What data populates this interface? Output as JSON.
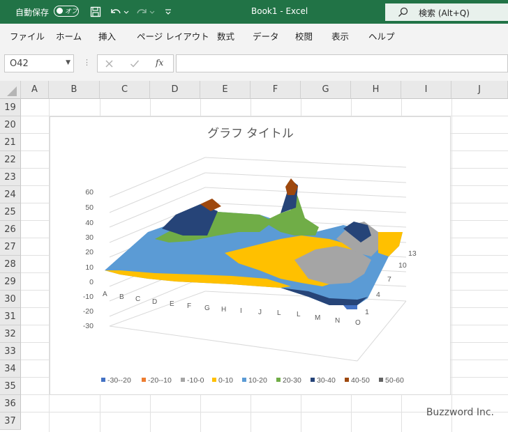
{
  "titlebar": {
    "autosave_label": "自動保存",
    "autosave_state": "オフ",
    "window_title": "Book1  -  Excel",
    "search_label": "検索 (Alt+Q)",
    "accent": "#217346"
  },
  "menu": [
    "ファイル",
    "ホーム",
    "挿入",
    "ページ レイアウト",
    "数式",
    "データ",
    "校閲",
    "表示",
    "ヘルプ"
  ],
  "formula_bar": {
    "name_box": "O42",
    "fx_label": "fx",
    "formula": ""
  },
  "columns": [
    "A",
    "B",
    "C",
    "D",
    "E",
    "F",
    "G",
    "H",
    "I",
    "J"
  ],
  "rows": [
    "19",
    "20",
    "21",
    "22",
    "23",
    "24",
    "25",
    "26",
    "27",
    "28",
    "29",
    "30",
    "31",
    "32",
    "33",
    "34",
    "35",
    "36",
    "37"
  ],
  "chart_data": {
    "type": "surface",
    "title": "グラフ タイトル",
    "z_ticks": [
      "60",
      "50",
      "40",
      "30",
      "20",
      "10",
      "0",
      "-10",
      "-20",
      "-30"
    ],
    "x_categories": [
      "A",
      "B",
      "C",
      "D",
      "E",
      "F",
      "G",
      "H",
      "I",
      "J",
      "L",
      "L",
      "M",
      "N",
      "O"
    ],
    "depth_ticks": [
      "1",
      "4",
      "7",
      "10",
      "13"
    ],
    "zlim": [
      -30,
      60
    ],
    "legend_position": "bottom",
    "series": [
      {
        "name": "-30--20",
        "color": "#4472c4"
      },
      {
        "name": "-20--10",
        "color": "#ed7d31"
      },
      {
        "name": "-10-0",
        "color": "#a5a5a5"
      },
      {
        "name": "0-10",
        "color": "#ffc000"
      },
      {
        "name": "10-20",
        "color": "#5b9bd5"
      },
      {
        "name": "20-30",
        "color": "#70ad47"
      },
      {
        "name": "30-40",
        "color": "#264478"
      },
      {
        "name": "40-50",
        "color": "#9e480e"
      },
      {
        "name": "50-60",
        "color": "#636363"
      }
    ]
  },
  "watermark": "Buzzword Inc."
}
